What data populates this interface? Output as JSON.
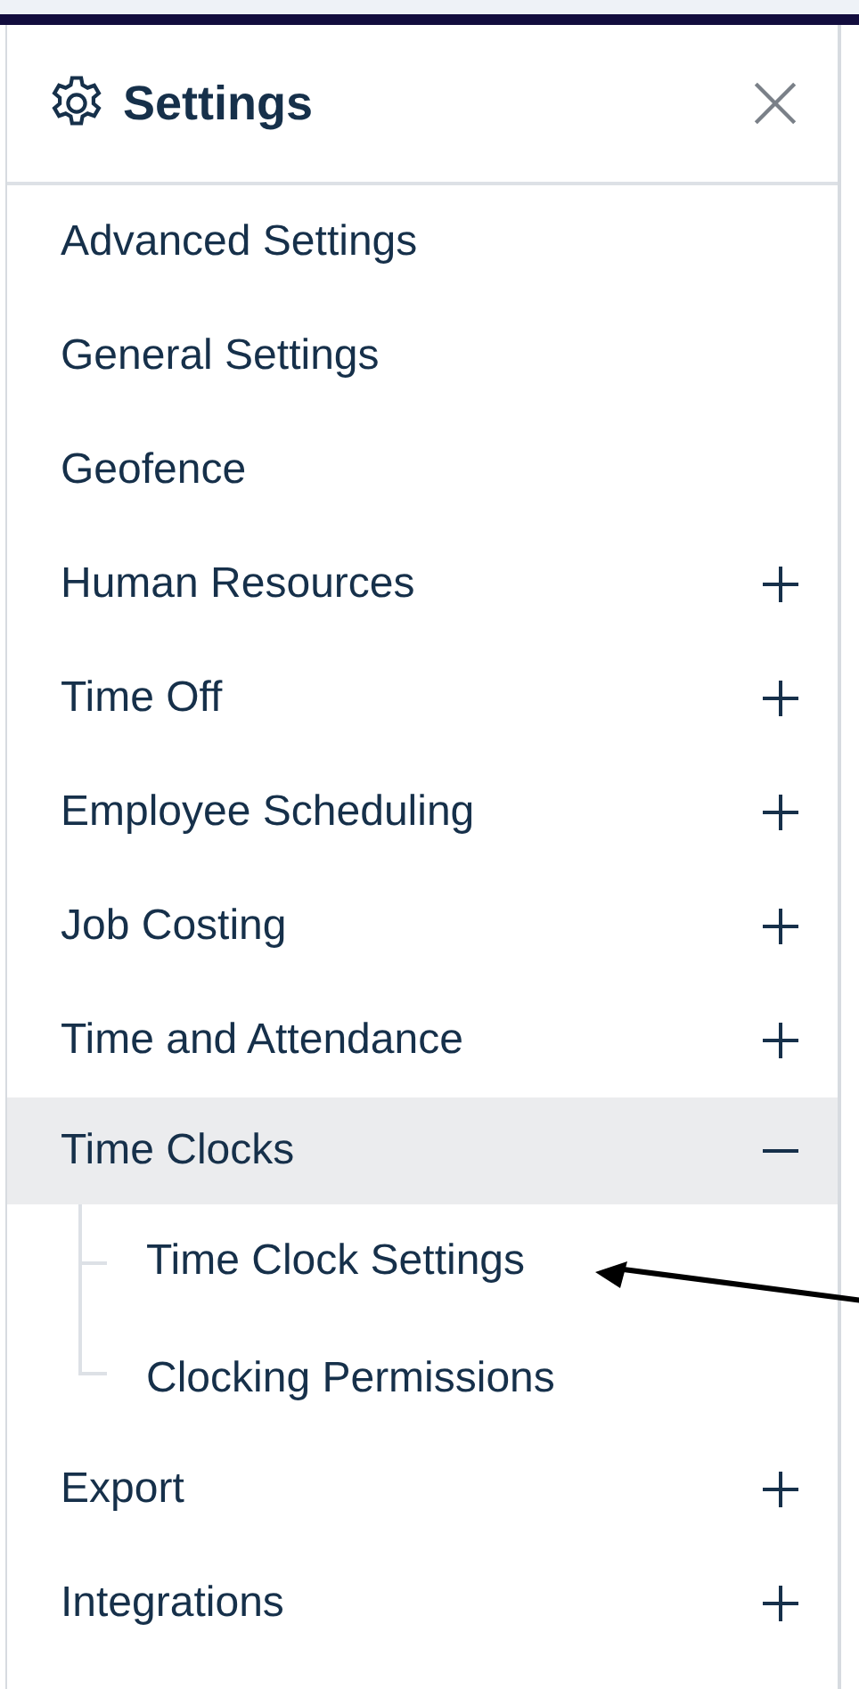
{
  "panel": {
    "title": "Settings"
  },
  "menu": [
    {
      "label": "Advanced Settings",
      "kind": "link"
    },
    {
      "label": "General Settings",
      "kind": "link"
    },
    {
      "label": "Geofence",
      "kind": "link"
    },
    {
      "label": "Human Resources",
      "kind": "group",
      "expanded": false
    },
    {
      "label": "Time Off",
      "kind": "group",
      "expanded": false
    },
    {
      "label": "Employee Scheduling",
      "kind": "group",
      "expanded": false
    },
    {
      "label": "Job Costing",
      "kind": "group",
      "expanded": false
    },
    {
      "label": "Time and Attendance",
      "kind": "group",
      "expanded": false
    },
    {
      "label": "Time Clocks",
      "kind": "group",
      "expanded": true,
      "children": [
        {
          "label": "Time Clock Settings",
          "annotated": true
        },
        {
          "label": "Clocking Permissions",
          "annotated": false
        }
      ]
    },
    {
      "label": "Export",
      "kind": "group",
      "expanded": false
    },
    {
      "label": "Integrations",
      "kind": "group",
      "expanded": false
    }
  ]
}
